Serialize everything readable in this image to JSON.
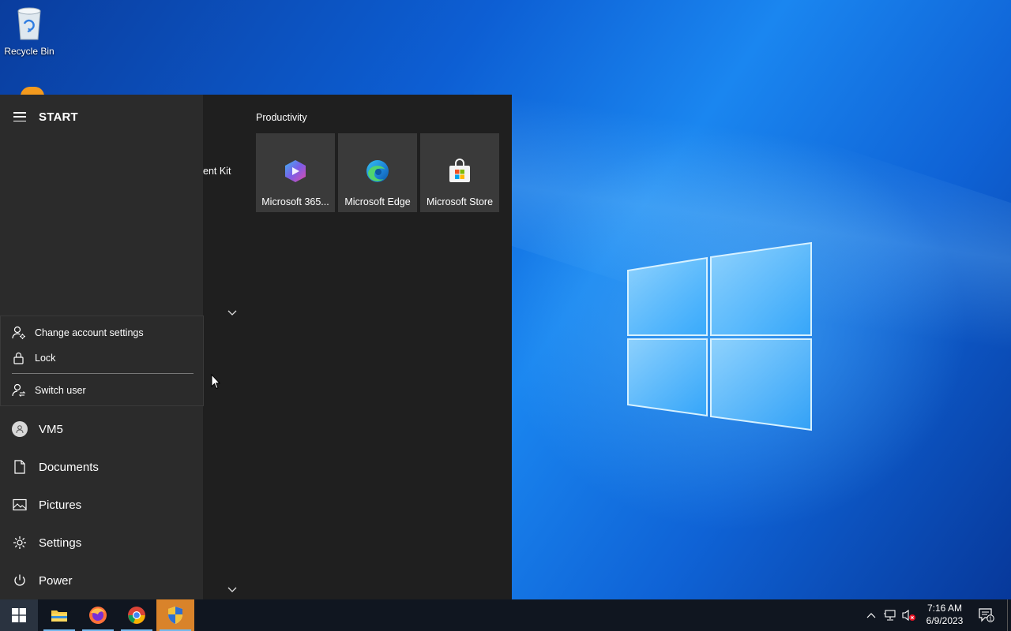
{
  "desktop": {
    "icons": [
      {
        "label": "Recycle Bin",
        "icon": "recycle-bin-icon"
      }
    ]
  },
  "start_menu": {
    "title": "START",
    "account_flyout": {
      "items": [
        {
          "label": "Change account settings",
          "icon": "account-settings-icon"
        },
        {
          "label": "Lock",
          "icon": "lock-icon"
        },
        {
          "label": "Switch user",
          "icon": "switch-user-icon"
        }
      ]
    },
    "rail_items": [
      {
        "label": "VM5",
        "icon": "user-avatar-icon"
      },
      {
        "label": "Documents",
        "icon": "document-icon"
      },
      {
        "label": "Pictures",
        "icon": "pictures-icon"
      },
      {
        "label": "Settings",
        "icon": "gear-icon"
      },
      {
        "label": "Power",
        "icon": "power-icon"
      }
    ],
    "partial_app_label": "ent Kit",
    "tile_group": {
      "label": "Productivity",
      "tiles": [
        {
          "label": "Microsoft 365...",
          "icon": "microsoft-365-icon"
        },
        {
          "label": "Microsoft Edge",
          "icon": "edge-icon"
        },
        {
          "label": "Microsoft Store",
          "icon": "store-icon"
        }
      ]
    }
  },
  "taskbar": {
    "apps": [
      {
        "name": "File Explorer",
        "icon": "file-explorer-icon"
      },
      {
        "name": "Firefox",
        "icon": "firefox-icon"
      },
      {
        "name": "Chrome",
        "icon": "chrome-icon"
      },
      {
        "name": "Windows Security",
        "icon": "security-shield-icon"
      }
    ],
    "clock": {
      "time": "7:16 AM",
      "date": "6/9/2023"
    },
    "notification_count": "1",
    "colors": {
      "taskbar": "#101620",
      "accent": "#76b9ed",
      "security_active": "#d9832a"
    }
  }
}
